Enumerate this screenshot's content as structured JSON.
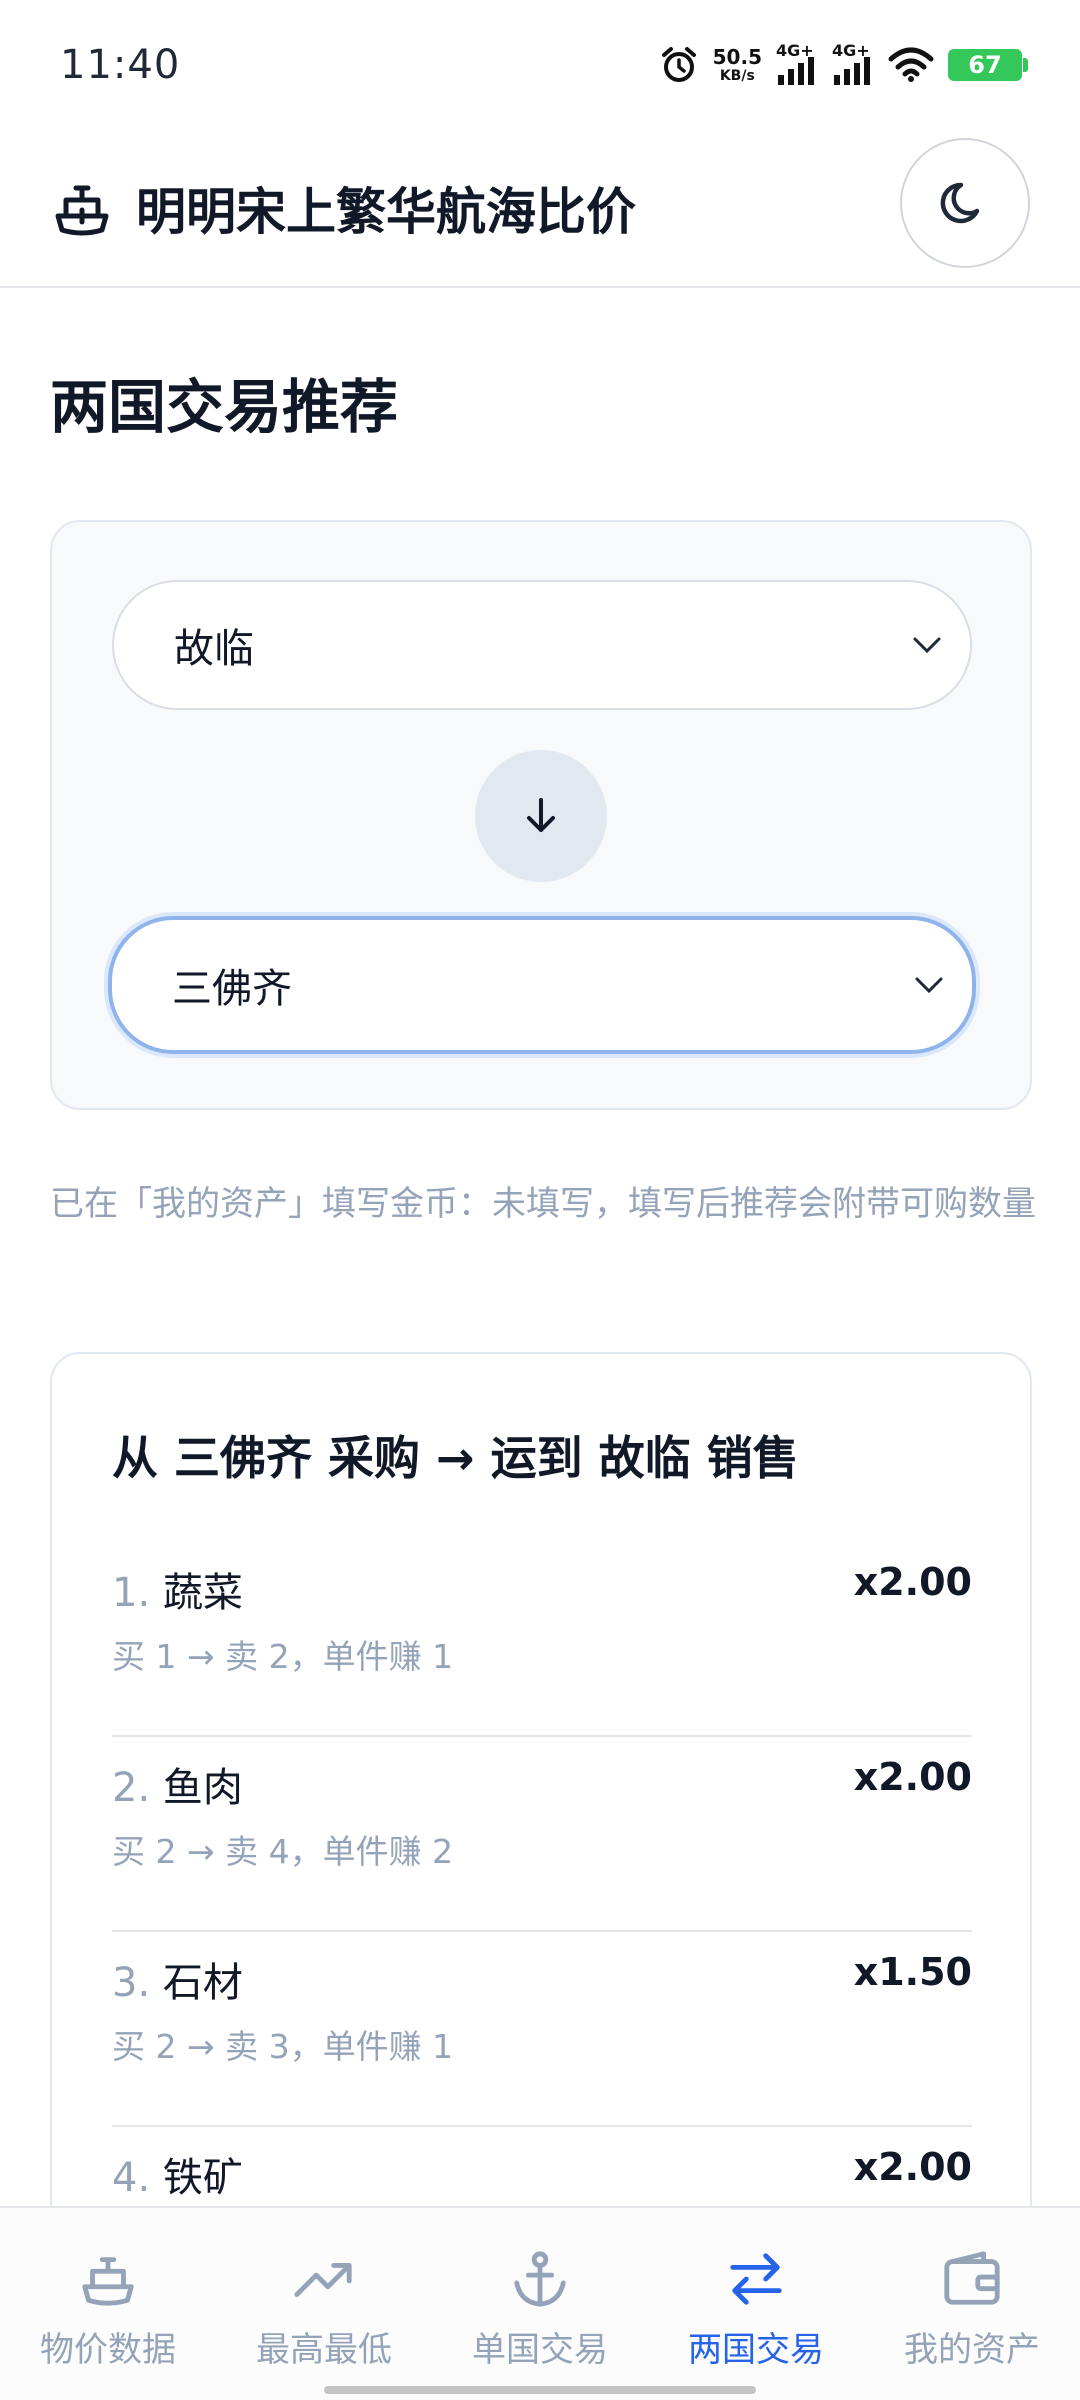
{
  "status_bar": {
    "time": "11:40",
    "net_speed": "50.5",
    "net_speed_unit": "KB/s",
    "signal1_label": "4G+",
    "signal2_label": "4G+",
    "battery": "67"
  },
  "header": {
    "title": "明明宋上繁华航海比价",
    "logo_icon": "ship-icon",
    "theme_icon": "moon-icon"
  },
  "page": {
    "title": "两国交易推荐",
    "from_select": {
      "value": "故临"
    },
    "to_select": {
      "value": "三佛齐"
    },
    "swap_icon": "arrow-down-icon",
    "gold_note": "已在「我的资产」填写金币：未填写，填写后推荐会附带可购数量"
  },
  "result": {
    "title": "从 三佛齐 采购 → 运到 故临 销售",
    "items": [
      {
        "index": "1.",
        "name": "蔬菜",
        "multiplier": "x2.00",
        "detail": "买 1 → 卖 2，单件赚 1"
      },
      {
        "index": "2.",
        "name": "鱼肉",
        "multiplier": "x2.00",
        "detail": "买 2 → 卖 4，单件赚 2"
      },
      {
        "index": "3.",
        "name": "石材",
        "multiplier": "x1.50",
        "detail": "买 2 → 卖 3，单件赚 1"
      },
      {
        "index": "4.",
        "name": "铁矿",
        "multiplier": "x2.00",
        "detail": ""
      }
    ]
  },
  "nav": {
    "items": [
      {
        "label": "物价数据",
        "icon": "ship-icon"
      },
      {
        "label": "最高最低",
        "icon": "trending-up-icon"
      },
      {
        "label": "单国交易",
        "icon": "anchor-icon"
      },
      {
        "label": "两国交易",
        "icon": "swap-arrows-icon",
        "active": true
      },
      {
        "label": "我的资产",
        "icon": "wallet-icon"
      }
    ]
  },
  "colors": {
    "accent": "#2563eb",
    "muted": "#94a3b8",
    "battery": "#34c759"
  }
}
